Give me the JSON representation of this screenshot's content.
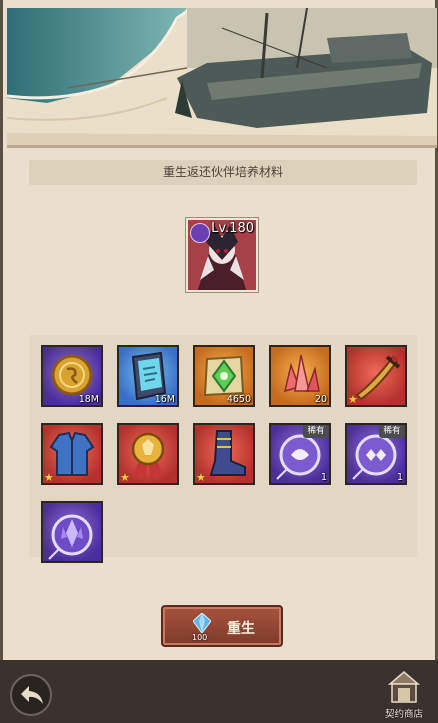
{
  "title": "重生返还伙伴培养材料",
  "hero": {
    "level": "Lv.180",
    "class_icon": "class-emblem-icon"
  },
  "materials": [
    {
      "icon": "gold-coin-icon",
      "bg": "purple",
      "count": "18M"
    },
    {
      "icon": "exp-book-icon",
      "bg": "purple",
      "count": "16M"
    },
    {
      "icon": "green-scroll-icon",
      "bg": "orange",
      "count": "4650"
    },
    {
      "icon": "red-crystal-icon",
      "bg": "orange",
      "count": "20"
    },
    {
      "icon": "sword-icon",
      "bg": "red",
      "count": ""
    },
    {
      "icon": "jacket-icon",
      "bg": "red",
      "count": ""
    },
    {
      "icon": "medal-icon",
      "bg": "red",
      "count": ""
    },
    {
      "icon": "boot-icon",
      "bg": "red",
      "count": ""
    },
    {
      "icon": "rare-orb-icon",
      "bg": "purple",
      "count": "1",
      "tag": "稀有"
    },
    {
      "icon": "rare-orb-icon",
      "bg": "purple",
      "count": "1",
      "tag": "稀有"
    },
    {
      "icon": "crystal-orb-icon",
      "bg": "purple",
      "count": ""
    }
  ],
  "rebirth_button": {
    "label": "重生",
    "cost": "100"
  },
  "bottom": {
    "back_icon": "back-arrow-icon",
    "shop_label": "契约商店"
  },
  "colors": {
    "panel": "#e9dfcc",
    "button": "#8f4633",
    "bar": "#3a332d"
  }
}
